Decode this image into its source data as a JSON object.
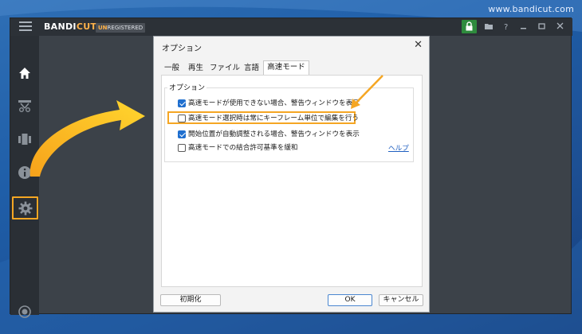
{
  "watermark": "www.bandicut.com",
  "app": {
    "brand_left": "BANDI",
    "brand_right": "CUT",
    "badge_left": "UN",
    "badge_right": "REGISTERED",
    "window_controls": [
      "folder-icon",
      "help-icon",
      "minimize-icon",
      "maximize-icon",
      "close-icon"
    ]
  },
  "sidebar": {
    "items": [
      {
        "icon": "home-icon",
        "active": false
      },
      {
        "icon": "cut-tools-icon",
        "active": false
      },
      {
        "icon": "join-clips-icon",
        "active": false
      },
      {
        "icon": "info-icon",
        "active": false
      },
      {
        "icon": "gear-icon",
        "active": true
      },
      {
        "icon": "record-icon",
        "active": false
      }
    ]
  },
  "dialog": {
    "title": "オプション",
    "tabs": [
      {
        "label": "一般",
        "active": false
      },
      {
        "label": "再生",
        "active": false
      },
      {
        "label": "ファイル",
        "active": false
      },
      {
        "label": "言語",
        "active": false
      },
      {
        "label": "高速モード",
        "active": true
      }
    ],
    "group_title": "オプション",
    "options": [
      {
        "label": "高速モードが使用できない場合、警告ウィンドウを表示",
        "checked": true,
        "highlighted": false
      },
      {
        "label": "高速モード選択時は常にキーフレーム単位で編集を行う",
        "checked": false,
        "highlighted": true
      },
      {
        "label": "開始位置が自動調整される場合、警告ウィンドウを表示",
        "checked": true,
        "highlighted": false
      },
      {
        "label": "高速モードでの結合許可基準を緩和",
        "checked": false,
        "highlighted": false
      }
    ],
    "help_link": "ヘルプ",
    "buttons": {
      "reset": "初期化",
      "ok": "OK",
      "cancel": "キャンセル"
    }
  },
  "colors": {
    "highlight": "#f5a623",
    "accent": "#1f6fcf",
    "app_bg": "#3c4249",
    "sidebar_bg": "#2a2f35",
    "lock_green": "#2e8b3d"
  }
}
